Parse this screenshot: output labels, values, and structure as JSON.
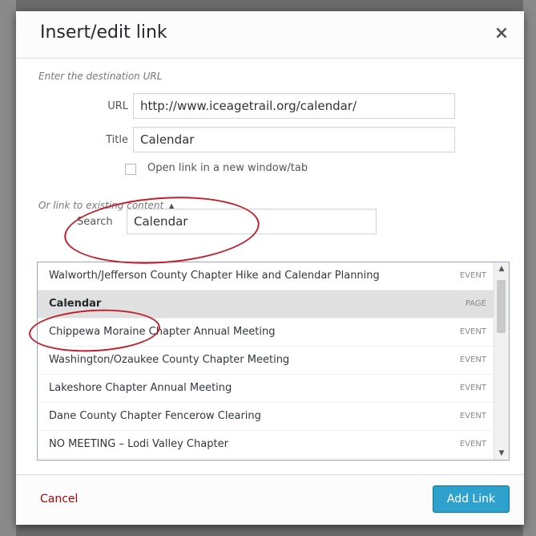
{
  "dialog": {
    "title": "Insert/edit link",
    "close_glyph": "×",
    "instructions": "Enter the destination URL"
  },
  "url_field": {
    "label": "URL",
    "value": "http://www.iceagetrail.org/calendar/"
  },
  "title_field": {
    "label": "Title",
    "value": "Calendar"
  },
  "new_tab": {
    "label": "Open link in a new window/tab",
    "checked": false
  },
  "existing_toggle": {
    "label": "Or link to existing content",
    "arrow": "▲"
  },
  "search_field": {
    "label": "Search",
    "value": "Calendar"
  },
  "results": [
    {
      "title": "Walworth/Jefferson County Chapter Hike and Calendar Planning",
      "type": "EVENT",
      "selected": false
    },
    {
      "title": "Calendar",
      "type": "PAGE",
      "selected": true
    },
    {
      "title": "Chippewa Moraine Chapter Annual Meeting",
      "type": "EVENT",
      "selected": false
    },
    {
      "title": "Washington/Ozaukee County Chapter Meeting",
      "type": "EVENT",
      "selected": false
    },
    {
      "title": "Lakeshore Chapter Annual Meeting",
      "type": "EVENT",
      "selected": false
    },
    {
      "title": "Dane County Chapter Fencerow Clearing",
      "type": "EVENT",
      "selected": false
    },
    {
      "title": "NO MEETING – Lodi Valley Chapter",
      "type": "EVENT",
      "selected": false
    }
  ],
  "scrollbar": {
    "up_glyph": "▲",
    "down_glyph": "▼"
  },
  "footer": {
    "cancel_label": "Cancel",
    "add_label": "Add Link"
  },
  "colors": {
    "primary_button": "#2ea2cc",
    "cancel_link": "#aa0000",
    "annotation": "#c0202a",
    "selected_row": "#e0e0e0"
  }
}
